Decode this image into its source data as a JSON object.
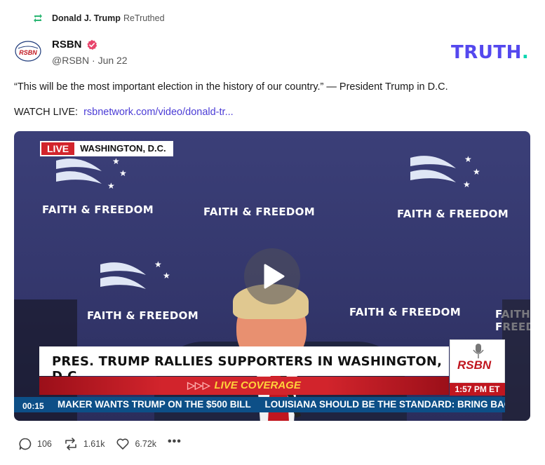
{
  "retruth": {
    "user": "Donald J. Trump",
    "label": "ReTruthed"
  },
  "author": {
    "name": "RSBN",
    "handle": "@RSBN",
    "date": "Jun 22",
    "avatar_text": "RSBN"
  },
  "logo": {
    "text": "TRUTH",
    "dot": "."
  },
  "post": {
    "text": "“This will be the most important election in the history of our country.” — President Trump in D.C.",
    "watch_label": "WATCH LIVE:",
    "link": "rsbnetwork.com/video/donald-tr..."
  },
  "video": {
    "live": "LIVE",
    "location": "WASHINGTON, D.C.",
    "banner": "FAITH & FREEDOM",
    "headline": "PRES. TRUMP RALLIES SUPPORTERS IN WASHINGTON, D.C.",
    "coverage": "LIVE COVERAGE",
    "coverage_arrows": "▷▷▷",
    "network": "RSBN",
    "time": "1:57 PM ET",
    "ticker_1": "MAKER WANTS TRUMP ON THE $500 BILL",
    "ticker_2": "LOUISIANA SHOULD BE THE STANDARD: BRING BACK",
    "timecode": "00:15"
  },
  "actions": {
    "replies": "106",
    "retruths": "1.61k",
    "likes": "6.72k",
    "more": "•••"
  },
  "colors": {
    "brand": "#5448ee",
    "brand_dot": "#0bd6b0",
    "link": "#4b3cd6",
    "verified": "#e8456c",
    "live_red": "#d2242c",
    "ticker_blue": "#0d4f87"
  }
}
